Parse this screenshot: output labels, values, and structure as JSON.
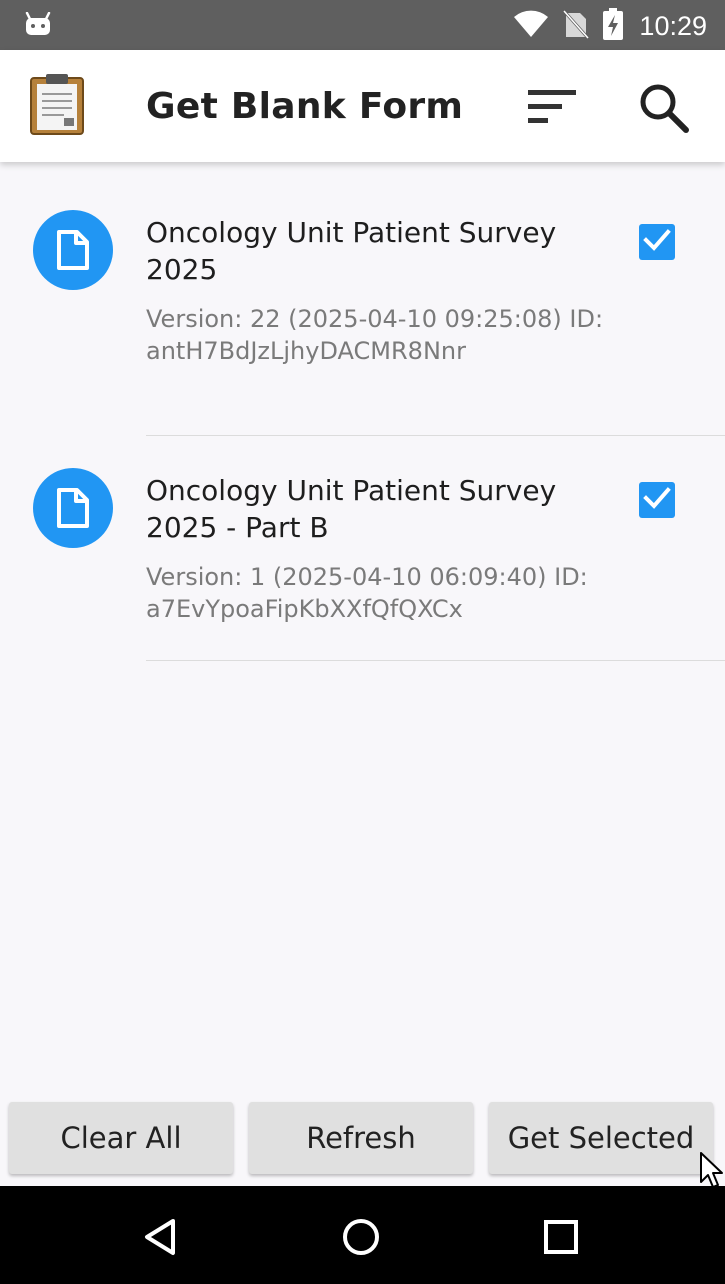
{
  "status_bar": {
    "time": "10:29",
    "icons": [
      "android-icon",
      "wifi-icon",
      "no-sim-icon",
      "battery-charging-icon"
    ]
  },
  "app_bar": {
    "title": "Get Blank Form",
    "icons": [
      "clipboard-logo-icon",
      "sort-icon",
      "search-icon"
    ]
  },
  "forms": [
    {
      "title": "Oncology Unit Patient Survey 2025",
      "meta": "Version: 22 (2025-04-10 09:25:08) ID: antH7BdJzLjhyDACMR8Nnr",
      "checked": true
    },
    {
      "title": "Oncology Unit Patient Survey 2025 - Part B",
      "meta": "Version: 1 (2025-04-10 06:09:40) ID: a7EvYpoaFipKbXXfQfQXCx",
      "checked": true
    }
  ],
  "buttons": {
    "clear_all": "Clear All",
    "refresh": "Refresh",
    "get_selected": "Get Selected"
  },
  "nav_bar": {
    "icons": [
      "back-icon",
      "home-icon",
      "recents-icon"
    ]
  },
  "colors": {
    "accent": "#2196f3",
    "status_bar": "#5f5f5f",
    "background": "#f8f7fa",
    "button": "#e0e0e0"
  }
}
